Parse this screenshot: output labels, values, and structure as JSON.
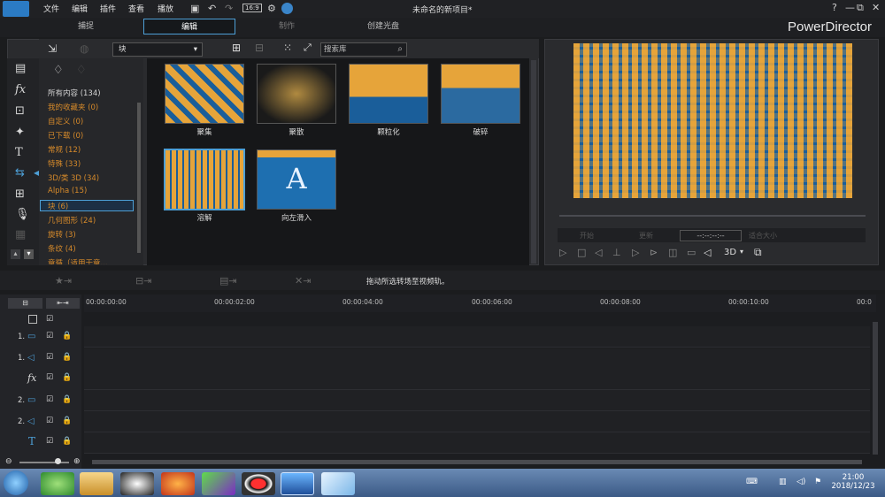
{
  "menu": [
    "文件",
    "编辑",
    "插件",
    "查看",
    "播放"
  ],
  "toolbar": {
    "ratio": "16:9"
  },
  "window_title": "未命名的新项目*",
  "window_buttons": [
    "?",
    "—",
    "⧉",
    "✕"
  ],
  "tabs": [
    "捕捉",
    "编辑",
    "制作",
    "创建光盘"
  ],
  "brand": "PowerDirector",
  "library": {
    "category_select": "块",
    "search_placeholder": "搜索库",
    "categories": [
      "所有内容 (134)",
      "我的收藏夹 (0)",
      "自定义 (0)",
      "已下载 (0)",
      "常规 (12)",
      "特殊 (33)",
      "3D/类 3D (34)",
      "Alpha (15)",
      "块 (6)",
      "几何图形 (24)",
      "旋转 (3)",
      "条纹 (4)",
      "章循（适用于章..."
    ],
    "thumbnails": [
      "聚集",
      "聚散",
      "颗粒化",
      "破碎",
      "溶解",
      "向左滑入"
    ]
  },
  "preview": {
    "timecode": "--:--:--:--",
    "buttons": [
      "开始",
      "更新",
      "适合大小"
    ],
    "mode": "3D"
  },
  "timeline": {
    "hint": "拖动所选转场至视频轨。",
    "ruler": [
      "00:00:00:00",
      "00:00:02:00",
      "00:00:04:00",
      "00:00:06:00",
      "00:00:08:00",
      "00:00:10:00",
      "00:0"
    ],
    "track_labels": [
      "1.",
      "1.",
      "",
      "2.",
      "2.",
      "",
      ""
    ]
  },
  "taskbar": {
    "time": "21:00",
    "date": "2018/12/23"
  },
  "colors": {
    "accent": "#4d9fd6",
    "category": "#d68a2a",
    "thumb_blue": "#1a5e9a",
    "thumb_orange": "#e6a43a"
  }
}
